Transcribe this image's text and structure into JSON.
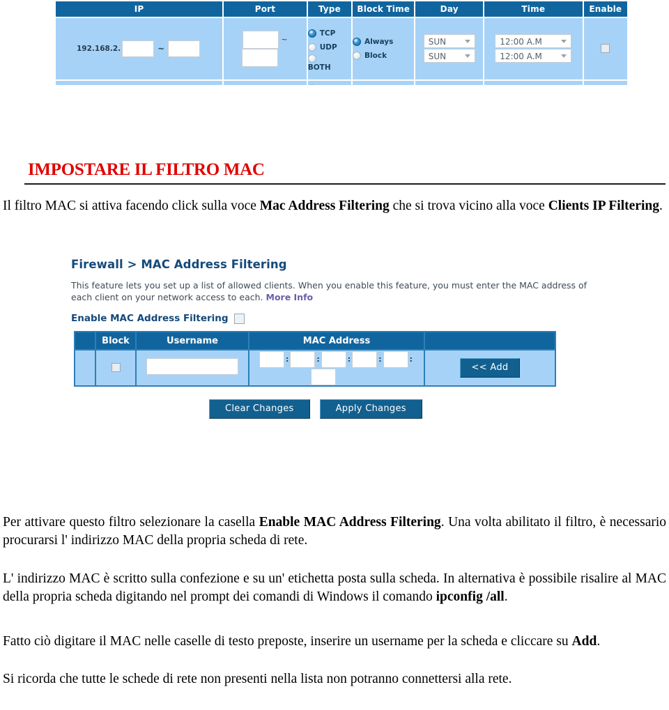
{
  "top_table": {
    "headers": [
      "IP",
      "Port",
      "Type",
      "Block Time",
      "Day",
      "Time",
      "Enable"
    ],
    "row": {
      "ip_prefix": "192.168.2.",
      "ip_range_separator": "~",
      "port_separator": "~",
      "type_options": [
        {
          "label": "TCP",
          "selected": true
        },
        {
          "label": "UDP",
          "selected": false
        },
        {
          "label": "BOTH",
          "selected": false
        }
      ],
      "block_time_options": [
        {
          "label": "Always",
          "selected": true
        },
        {
          "label": "Block",
          "selected": false
        }
      ],
      "day_from": "SUN",
      "day_to": "SUN",
      "time_from": "12:00 A.M",
      "time_to": "12:00 A.M"
    }
  },
  "section": {
    "heading": "IMPOSTARE IL FILTRO MAC"
  },
  "paragraphs": {
    "p1_a": "Il filtro MAC si attiva facendo click sulla voce ",
    "p1_b": "Mac Address Filtering",
    "p1_c": " che si trova vicino alla voce ",
    "p1_d": "Clients IP Filtering",
    "p1_e": ".",
    "p2_a": "Per attivare questo filtro selezionare la casella ",
    "p2_b": "Enable MAC Address Filtering",
    "p2_c": ". Una volta abilitato il filtro, è necessario procurarsi l' indirizzo MAC della propria scheda di rete.",
    "p3_a": "L' indirizzo MAC è scritto sulla confezione e su un' etichetta posta sulla scheda. In alternativa è possibile risalire al MAC della propria scheda digitando nel prompt dei comandi di Windows il comando ",
    "p3_b": "ipconfig /all",
    "p3_c": ".",
    "p4_a": "Fatto ciò digitare il MAC nelle caselle di testo preposte, inserire un username per la scheda e cliccare su ",
    "p4_b": "Add",
    "p4_c": ".",
    "p5_a": "Si ricorda che tutte le schede di rete non presenti nella lista non potranno connettersi alla rete."
  },
  "mac_panel": {
    "title": "Firewall > MAC Address Filtering",
    "description": "This feature lets you set up a list of allowed clients. When you enable this feature, you must enter the MAC address of each client on your network access to each. ",
    "more_info": "More Info",
    "enable_label": "Enable MAC Address Filtering",
    "table_headers": [
      "Block",
      "Username",
      "MAC Address",
      ""
    ],
    "mac_separator": ":",
    "add_button": "<< Add",
    "clear_button": "Clear Changes",
    "apply_button": "Apply Changes"
  }
}
